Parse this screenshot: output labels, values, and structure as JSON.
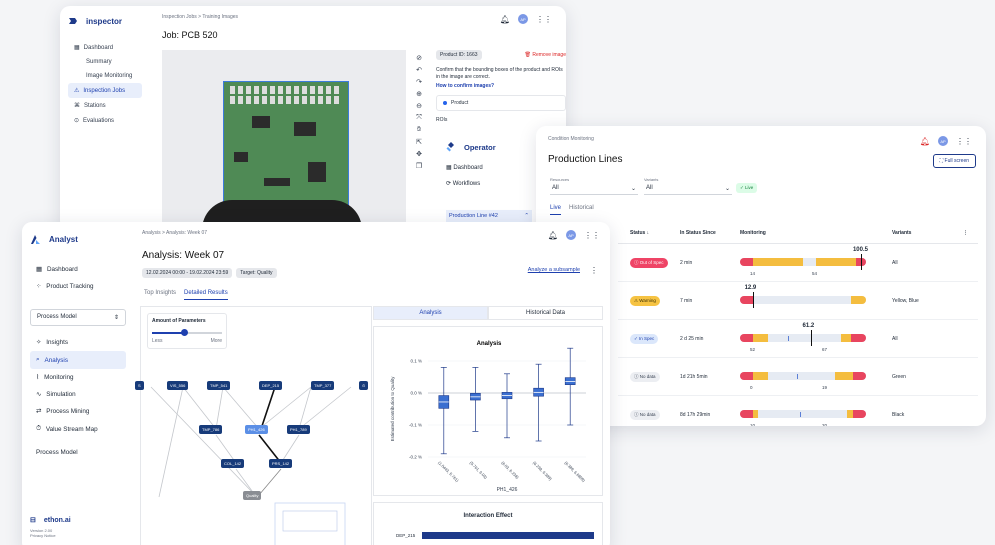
{
  "inspector": {
    "brand": "inspector",
    "nav": [
      {
        "label": "Dashboard",
        "sub": false,
        "active": false
      },
      {
        "label": "Summary",
        "sub": true,
        "active": false
      },
      {
        "label": "Image Monitoring",
        "sub": true,
        "active": false
      },
      {
        "label": "Inspection Jobs",
        "sub": false,
        "active": true
      },
      {
        "label": "Stations",
        "sub": false,
        "active": false
      },
      {
        "label": "Evaluations",
        "sub": false,
        "active": false
      }
    ],
    "breadcrumb": "Inspection Jobs  >  Training Images",
    "title": "Job: PCB 520",
    "avatar": "AP",
    "product_id": "Product ID: 1663",
    "remove": "Remove image",
    "instruction": "Confirm that the bounding boxes of the product and ROIs in the image are correct.",
    "howto": "How to confirm images?",
    "product_label": "Product",
    "rois_label": "ROIs"
  },
  "operator": {
    "brand": "Operator",
    "nav": [
      "Dashboard",
      "Workflows"
    ],
    "line": "Production Line #42"
  },
  "condition": {
    "breadcrumb": "Condition Monitoring",
    "title": "Production Lines",
    "avatar": "AP",
    "fullscreen": "Full screen",
    "resources_label": "Resources",
    "resources_value": "All",
    "variants_label": "Variants",
    "variants_value": "All",
    "live": "Live",
    "tabs": [
      "Live",
      "Historical"
    ],
    "headers": {
      "status": "Status",
      "since": "In Status Since",
      "monitoring": "Monitoring",
      "variants": "Variants"
    },
    "rows": [
      {
        "status": "Out of Spec",
        "cls": "st-out",
        "since": "2 min",
        "variant": "All",
        "value": "100.5",
        "lo": "14",
        "hi": "54"
      },
      {
        "status": "Warning",
        "cls": "st-warn",
        "since": "7 min",
        "variant": "Yellow, Blue",
        "value": "12.9",
        "lo": "",
        "hi": ""
      },
      {
        "status": "In Spec",
        "cls": "st-spec",
        "since": "2 d 25 min",
        "variant": "All",
        "value": "61.2",
        "lo": "52",
        "hi": "67"
      },
      {
        "status": "No data",
        "cls": "st-none",
        "since": "1d 21h 5min",
        "variant": "Green",
        "value": "",
        "lo": "0",
        "hi": "19"
      },
      {
        "status": "No data",
        "cls": "st-none",
        "since": "8d 17h 29min",
        "variant": "Black",
        "value": "",
        "lo": "10",
        "hi": "20"
      }
    ]
  },
  "analyst": {
    "brand": "Analyst",
    "nav_top": [
      "Dashboard",
      "Product Tracking"
    ],
    "model_select": "Process Model",
    "nav": [
      "Insights",
      "Analysis",
      "Monitoring",
      "Simulation",
      "Process Mining",
      "Value Stream Map"
    ],
    "active": "Analysis",
    "footer_section": "Process Model",
    "footer_brand": "ethon.ai",
    "version": "Version 2.00",
    "privacy": "Privacy Notice",
    "breadcrumb": "Analysis  >  Analysis: Week 07",
    "title": "Analysis: Week 07",
    "avatar": "AP",
    "date_range": "12.02.2024 00:00 - 19.02.2024 23:59",
    "target": "Target: Quality",
    "subsample": "Analyze a subsample",
    "tabs": [
      "Top Insights",
      "Detailed Results"
    ],
    "params_title": "Amount of Parameters",
    "params_less": "Less",
    "params_more": "More",
    "nodes": [
      "VIS_556",
      "TMP_541",
      "DEP_215",
      "TMP_377",
      "TMP_786",
      "PH1_426",
      "PH1_789",
      "COL_142",
      "PRS_142",
      "Quality"
    ],
    "right_tabs": [
      "Analysis",
      "Historical Data"
    ],
    "interaction_title": "Interaction Effect",
    "interaction_label": "DEP_215"
  },
  "chart_data": {
    "type": "box",
    "title": "Analysis",
    "xlabel": "PH1_426",
    "ylabel": "Estimated contribution to Quality",
    "categories": [
      "(1.0443, 5.761)",
      "(5.761, 6.03)",
      "(6.03, 6.238)",
      "(6.238, 6.389)",
      "(6.389, 6.6859)"
    ],
    "yticks": [
      "0.1 %",
      "0.0 %",
      "-0.1 %",
      "-0.2 %"
    ],
    "ylim": [
      -0.2,
      0.1
    ],
    "boxes": [
      {
        "min": -0.19,
        "q1": -0.048,
        "median": -0.028,
        "q3": -0.008,
        "max": 0.08
      },
      {
        "min": -0.12,
        "q1": -0.022,
        "median": -0.012,
        "q3": -0.001,
        "max": 0.08
      },
      {
        "min": -0.14,
        "q1": -0.018,
        "median": -0.008,
        "q3": 0.002,
        "max": 0.06
      },
      {
        "min": -0.15,
        "q1": -0.01,
        "median": 0.002,
        "q3": 0.015,
        "max": 0.09
      },
      {
        "min": -0.1,
        "q1": 0.026,
        "median": 0.036,
        "q3": 0.048,
        "max": 0.14
      }
    ]
  }
}
